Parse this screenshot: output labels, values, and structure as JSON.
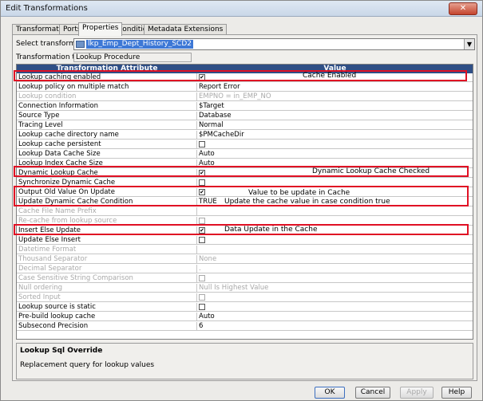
{
  "window": {
    "title": "Edit Transformations",
    "close_glyph": "✕"
  },
  "tabs": [
    {
      "label": "Transformation"
    },
    {
      "label": "Ports"
    },
    {
      "label": "Properties",
      "active": true
    },
    {
      "label": "Condition"
    },
    {
      "label": "Metadata Extensions"
    }
  ],
  "form": {
    "select_label": "Select transformation:",
    "select_value": "lkp_Emp_Dept_History_SCD2",
    "type_label": "Transformation type:",
    "type_value": "Lookup Procedure"
  },
  "grid": {
    "col_attr": "Transformation Attribute",
    "col_value": "Value",
    "rows": [
      {
        "attr": "Lookup caching enabled",
        "value": "",
        "checkbox": true,
        "checked": true
      },
      {
        "attr": "Lookup policy on multiple match",
        "value": "Report Error"
      },
      {
        "attr": "Lookup condition",
        "value": "EMPNO = in_EMP_NO",
        "disabled": true
      },
      {
        "attr": "Connection Information",
        "value": "$Target"
      },
      {
        "attr": "Source Type",
        "value": "Database"
      },
      {
        "attr": "Tracing Level",
        "value": "Normal"
      },
      {
        "attr": "Lookup cache directory name",
        "value": "$PMCacheDir"
      },
      {
        "attr": "Lookup cache persistent",
        "value": "",
        "checkbox": true,
        "checked": false
      },
      {
        "attr": "Lookup Data Cache Size",
        "value": "Auto"
      },
      {
        "attr": "Lookup Index Cache Size",
        "value": "Auto"
      },
      {
        "attr": "Dynamic Lookup Cache",
        "value": "",
        "checkbox": true,
        "checked": true
      },
      {
        "attr": "Synchronize Dynamic Cache",
        "value": "",
        "checkbox": true,
        "checked": false
      },
      {
        "attr": "Output Old Value On Update",
        "value": "",
        "checkbox": true,
        "checked": true
      },
      {
        "attr": "Update Dynamic Cache Condition",
        "value": "TRUE"
      },
      {
        "attr": "Cache File Name Prefix",
        "value": "",
        "disabled": true
      },
      {
        "attr": "Re-cache from lookup source",
        "value": "",
        "checkbox": true,
        "checked": false,
        "disabled": true
      },
      {
        "attr": "Insert Else Update",
        "value": "",
        "checkbox": true,
        "checked": true
      },
      {
        "attr": "Update Else Insert",
        "value": "",
        "checkbox": true,
        "checked": false
      },
      {
        "attr": "Datetime Format",
        "value": "",
        "disabled": true
      },
      {
        "attr": "Thousand Separator",
        "value": "None",
        "disabled": true
      },
      {
        "attr": "Decimal Separator",
        "value": ".",
        "disabled": true
      },
      {
        "attr": "Case Sensitive String Comparison",
        "value": "",
        "checkbox": true,
        "checked": false,
        "disabled": true
      },
      {
        "attr": "Null ordering",
        "value": "Null Is Highest Value",
        "disabled": true
      },
      {
        "attr": "Sorted Input",
        "value": "",
        "checkbox": true,
        "checked": false,
        "disabled": true
      },
      {
        "attr": "Lookup source is static",
        "value": "",
        "checkbox": true,
        "checked": false
      },
      {
        "attr": "Pre-build lookup cache",
        "value": "Auto"
      },
      {
        "attr": "Subsecond Precision",
        "value": "6"
      }
    ]
  },
  "annotations": {
    "cache_enabled": "Cache Enabled",
    "dynamic_checked": "Dynamic Lookup Cache Checked",
    "old_value": "Value to be update in Cache",
    "condition_true": "Update the cache value in case condition true",
    "data_update": "Data Update in the Cache"
  },
  "description": {
    "title": "Lookup Sql Override",
    "text": "Replacement query for lookup values"
  },
  "buttons": {
    "ok": "OK",
    "cancel": "Cancel",
    "apply": "Apply",
    "help": "Help"
  },
  "colors": {
    "header": "#2f4f86",
    "highlight": "#e01024",
    "selection": "#3d78d6"
  }
}
